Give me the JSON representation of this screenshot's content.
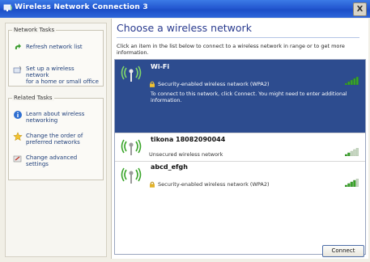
{
  "window": {
    "title": "Wireless Network Connection 3",
    "close_label": "X"
  },
  "sidebar": {
    "network_tasks": {
      "title": "Network Tasks",
      "items": [
        {
          "label": "Refresh network list",
          "icon": "refresh-icon"
        },
        {
          "label": "Set up a wireless network\nfor a home or small office",
          "icon": "setup-network-icon"
        }
      ]
    },
    "related_tasks": {
      "title": "Related Tasks",
      "items": [
        {
          "label": "Learn about wireless\nnetworking",
          "icon": "info-icon"
        },
        {
          "label": "Change the order of\npreferred networks",
          "icon": "star-icon"
        },
        {
          "label": "Change advanced\nsettings",
          "icon": "settings-icon"
        }
      ]
    }
  },
  "main": {
    "heading": "Choose a wireless network",
    "instructions": "Click an item in the list below to connect to a wireless network in range or to get more information.",
    "networks": [
      {
        "name": "Wi-Fi",
        "status": "Security-enabled wireless network (WPA2)",
        "description": "To connect to this network, click Connect. You might need to enter additional information.",
        "selected": true,
        "signal": 1.0
      },
      {
        "name": "tikona 18082090044",
        "status": "Unsecured wireless network",
        "selected": false,
        "signal": 0.4
      },
      {
        "name": "abcd_efgh",
        "status": "Security-enabled wireless network (WPA2)",
        "selected": false,
        "signal": 0.8
      }
    ],
    "connect_label": "Connect"
  },
  "colors": {
    "selected_bg": "#2d4c8f",
    "signal_green": "#3aa52a",
    "link_blue": "#1f3f7a"
  }
}
